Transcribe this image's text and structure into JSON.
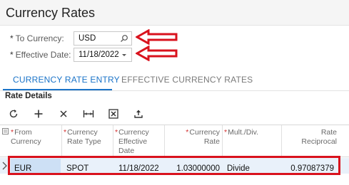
{
  "page": {
    "title": "Currency Rates"
  },
  "form": {
    "to_currency_label": "To Currency:",
    "to_currency_value": "USD",
    "effective_date_label": "Effective Date:",
    "effective_date_value": "11/18/2022",
    "required_mark": "*"
  },
  "tabs": [
    {
      "label": "CURRENCY RATE ENTRY",
      "active": true
    },
    {
      "label": "EFFECTIVE CURRENCY RATES",
      "active": false
    }
  ],
  "section": {
    "title": "Rate Details"
  },
  "toolbar": {
    "icons": [
      "refresh-icon",
      "add-icon",
      "delete-icon",
      "fit-columns-icon",
      "export-excel-icon",
      "upload-icon"
    ]
  },
  "grid": {
    "columns": [
      {
        "line1": "From",
        "line2": "Currency",
        "line3": "",
        "required": true
      },
      {
        "line1": "Currency",
        "line2": "Rate Type",
        "line3": "",
        "required": true
      },
      {
        "line1": "Currency",
        "line2": "Effective",
        "line3": "Date",
        "required": true
      },
      {
        "line1": "Currency",
        "line2": "Rate",
        "line3": "",
        "required": true
      },
      {
        "line1": "Mult./Div.",
        "line2": "",
        "line3": "",
        "required": true
      },
      {
        "line1": "Rate",
        "line2": "Reciprocal",
        "line3": "",
        "required": false
      }
    ],
    "rows": [
      {
        "from_currency": "EUR",
        "rate_type": "SPOT",
        "effective_date": "11/18/2022",
        "rate": "1.03000000",
        "mult_div": "Divide",
        "reciprocal": "0.97087379"
      }
    ]
  },
  "colors": {
    "accent": "#1a73c8",
    "annotation": "#d9121d",
    "required": "#d32f2f",
    "row_selected": "#e9f1fa"
  }
}
